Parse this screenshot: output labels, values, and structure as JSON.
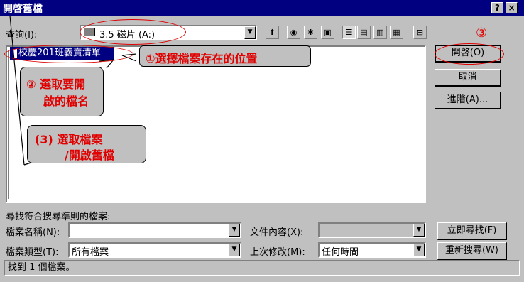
{
  "window": {
    "title": "開啓舊檔",
    "help_btn": "?",
    "close_btn": "×"
  },
  "lookin": {
    "label": "查詢(I):",
    "value": "3.5 磁片 (A:)"
  },
  "file_list": {
    "selected_file": "校慶201班義賣清單"
  },
  "buttons": {
    "open": "開啓(O)",
    "cancel": "取消",
    "advanced": "進階(A)...",
    "find_now": "立即尋找(F)",
    "new_search": "重新搜尋(W)"
  },
  "search": {
    "heading": "尋找符合搜尋準則的檔案:",
    "filename_label": "檔案名稱(N):",
    "filename_value": "",
    "filetype_label": "檔案類型(T):",
    "filetype_value": "所有檔案",
    "content_label": "文件內容(X):",
    "content_value": "",
    "modified_label": "上次修改(M):",
    "modified_value": "任何時間"
  },
  "status": {
    "text": "找到 1 個檔案。"
  },
  "annotations": {
    "callout1": "①選擇檔案存在的位置",
    "callout2_line1": "② 選取要開",
    "callout2_line2": "啟的檔名",
    "callout3_line1": "(3) 選取檔案",
    "callout3_line2": "/開啟舊檔",
    "label3": "③",
    "color": "#e00000"
  }
}
